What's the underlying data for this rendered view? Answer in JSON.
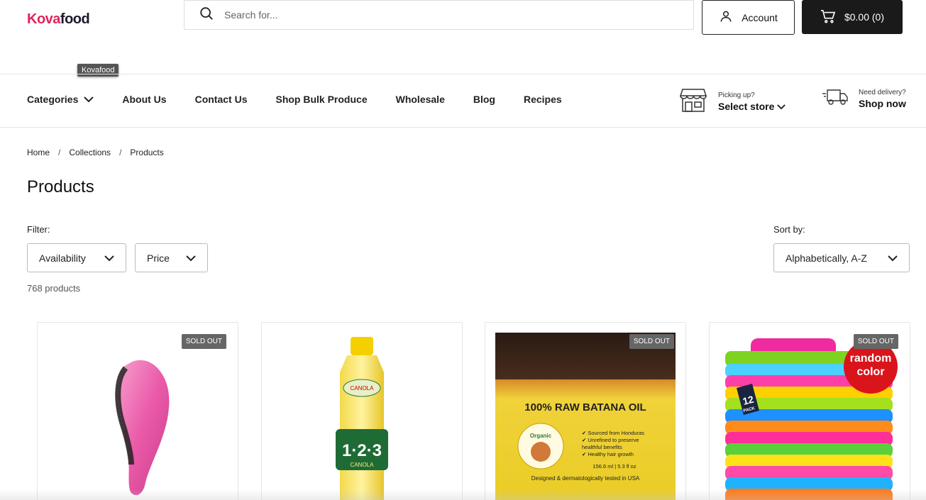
{
  "header": {
    "logo_left": "Kova",
    "logo_right": "food",
    "tooltip": "Kovafood",
    "search_placeholder": "Search for...",
    "account_label": "Account",
    "cart_label": "$0.00 (0)"
  },
  "nav": {
    "items": [
      {
        "label": "Categories"
      },
      {
        "label": "About Us"
      },
      {
        "label": "Contact Us"
      },
      {
        "label": "Shop Bulk Produce"
      },
      {
        "label": "Wholesale"
      },
      {
        "label": "Blog"
      },
      {
        "label": "Recipes"
      }
    ],
    "pickup_small": "Picking up?",
    "pickup_big": "Select store",
    "delivery_small": "Need delivery?",
    "delivery_big": "Shop now"
  },
  "breadcrumb": [
    "Home",
    "Collections",
    "Products"
  ],
  "page_title": "Products",
  "filters": {
    "label": "Filter:",
    "availability": "Availability",
    "price": "Price",
    "sort_label": "Sort by:",
    "sort_value": "Alphabetically, A-Z",
    "count": "768 products"
  },
  "products": [
    {
      "badge": "SOLD OUT",
      "image": "pink-hair-brush"
    },
    {
      "badge": "",
      "image": "canola-oil-bottle",
      "bottle_top": "CANOLA",
      "bottle_number": "1·2·3",
      "bottle_bottom": "CANOLA"
    },
    {
      "badge": "SOLD OUT",
      "image": "batana-oil-jar",
      "jar_title": "100% RAW BATANA OIL",
      "jar_organic": "Organic",
      "jar_bullets": [
        "✔ Sourced from Honduras",
        "✔ Unrefined to preserve",
        "  healthful benefits",
        "✔ Healthy hair growth"
      ],
      "jar_volume": "156.6 ml | 5.3 fl oz",
      "jar_footer": "Designed & dermatologically tested in USA"
    },
    {
      "badge": "SOLD OUT",
      "image": "microfiber-towels",
      "tag_line1": "random",
      "tag_line2": "color",
      "pack_number": "12",
      "pack_word": "PACK"
    }
  ],
  "colors": {
    "brand_pink": "#e0245e",
    "dark": "#1a1a1a",
    "badge": "#666666"
  }
}
